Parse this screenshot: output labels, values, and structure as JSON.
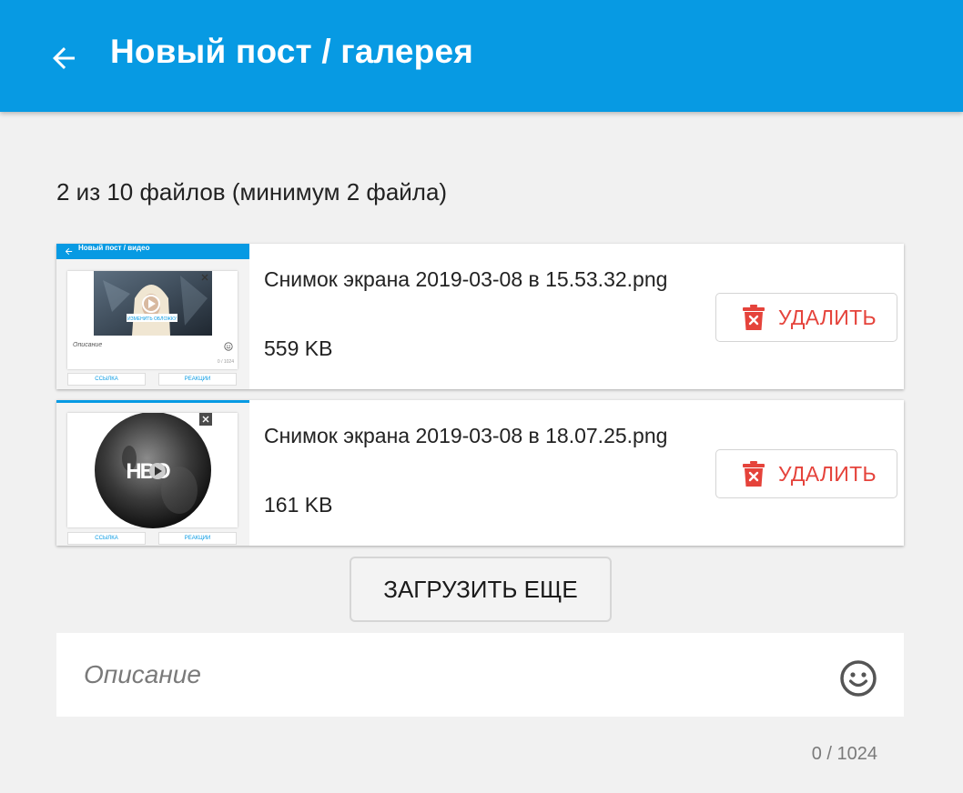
{
  "header": {
    "title": "Новый пост / галерея",
    "back_icon": "arrow-left-icon",
    "background": "#079ae3"
  },
  "summary": {
    "count_text": "2 из 10 файлов (минимум 2 файла)"
  },
  "files": [
    {
      "name": "Снимок экрана 2019-03-08 в 15.53.32.png",
      "size": "559 KB",
      "delete_label": "УДАЛИТЬ",
      "thumbnail": {
        "header_text": "Новый пост / видео",
        "cover_button": "ИЗМЕНИТЬ ОБЛОЖКУ",
        "description": "Описание",
        "counter": "0 / 1024",
        "link_button": "ССЫЛКА",
        "reactions_button": "РЕАКЦИИ"
      }
    },
    {
      "name": "Снимок экрана 2019-03-08 в 18.07.25.png",
      "size": "161 KB",
      "delete_label": "УДАЛИТЬ",
      "thumbnail": {
        "logo_text": "HBO",
        "link_button": "ССЫЛКА",
        "reactions_button": "РЕАКЦИИ"
      }
    }
  ],
  "actions": {
    "load_more_label": "ЗАГРУЗИТЬ ЕЩЕ"
  },
  "description": {
    "placeholder": "Описание",
    "value": "",
    "emoji_icon": "smiley-icon",
    "counter": "0 / 1024"
  },
  "colors": {
    "accent": "#079ae3",
    "danger": "#e5433b"
  }
}
